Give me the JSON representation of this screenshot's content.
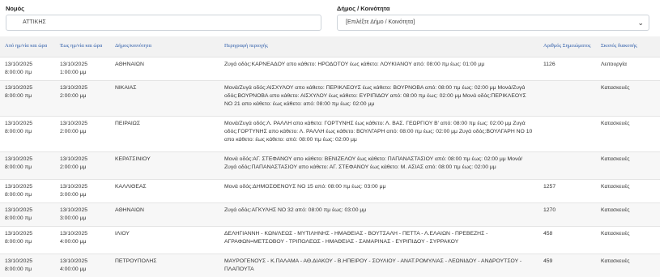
{
  "filters": {
    "prefecture": {
      "label": "Νομός",
      "value": "ΑΤΤΙΚΗΣ"
    },
    "municipality": {
      "label": "Δήμος / Κοινότητα",
      "value": "[Επιλέξτε Δήμο / Κοινότητα]"
    }
  },
  "table": {
    "headers": {
      "from": "Από ημ/νία και ώρα",
      "to": "Έως ημ/νία και ώρα",
      "municipality": "Δήμος/κοινότητα",
      "description": "Περιγραφή περιοχής",
      "count": "Αριθμός Σημειώματος",
      "purpose": "Σκοπός διακοπής"
    },
    "rows": [
      {
        "from_date": "13/10/2025",
        "from_time": "8:00:00 πμ",
        "to_date": "13/10/2025",
        "to_time": "1:00:00 μμ",
        "municipality": "ΑΘΗΝΑΙΩΝ",
        "description": "Ζυγά οδός:ΚΑΡΝΕΑΔΟΥ απο κάθετο: ΗΡΟΔΟΤΟΥ έως κάθετο: ΛΟΥΚΙΑΝΟΥ από: 08:00 πμ έως: 01:00 μμ",
        "count": "1126",
        "purpose": "Λειτουργία"
      },
      {
        "from_date": "13/10/2025",
        "from_time": "8:00:00 πμ",
        "to_date": "13/10/2025",
        "to_time": "2:00:00 μμ",
        "municipality": "ΝΙΚΑΙΑΣ",
        "description": "Μονά/Ζυγά οδός:ΑΙΣΧΥΛΟΥ απο κάθετο: ΠΕΡΙΚΛΕΟΥΣ έως κάθετο: ΒΟΥΡΝΟΒΑ από: 08:00 πμ έως: 02:00 μμ Μονά/Ζυγά οδός:ΒΟΥΡΝΟΒΑ απο κάθετο: ΑΙΣΧΥΛΟΥ έως κάθετο: ΕΥΡΙΠΙΔΟΥ από: 08:00 πμ έως: 02:00 μμ Μονά οδός:ΠΕΡΙΚΛΕΟΥΣ ΝΟ 21 απο κάθετο: έως κάθετο: από: 08:00 πμ έως: 02:00 μμ",
        "count": "",
        "purpose": "Κατασκευές"
      },
      {
        "from_date": "13/10/2025",
        "from_time": "8:00:00 πμ",
        "to_date": "13/10/2025",
        "to_time": "2:00:00 μμ",
        "municipality": "ΠΕΙΡΑΙΩΣ",
        "description": "Μονά/Ζυγά οδός:Λ. ΡΑΛΛΗ απο κάθετο: ΓΟΡΤΥΝΗΣ έως κάθετο: Λ. ΒΑΣ. ΓΕΩΡΓΙΟΥ Β' από: 08:00 πμ έως: 02:00 μμ Ζυγά οδός:ΓΟΡΤΥΝΗΣ απο κάθετο: Λ. ΡΑΛΛΗ έως κάθετο: ΒΟΥΛΓΑΡΗ από: 08:00 πμ έως: 02:00 μμ Ζυγά οδός:ΒΟΥΛΓΑΡΗ ΝΟ 10 απο κάθετο: έως κάθετο: από: 08:00 πμ έως: 02:00 μμ",
        "count": "",
        "purpose": "Κατασκευές"
      },
      {
        "from_date": "13/10/2025",
        "from_time": "8:00:00 πμ",
        "to_date": "13/10/2025",
        "to_time": "2:00:00 μμ",
        "municipality": "ΚΕΡΑΤΣΙΝΙΟΥ",
        "description": "Μονά οδός:ΑΓ. ΣΤΕΦΑΝΟΥ απο κάθετο: ΒΕΝΙΖΕΛΟΥ έως κάθετο: ΠΑΠΑΝΑΣΤΑΣΙΟΥ από: 08:00 πμ έως: 02:00 μμ Μονά/Ζυγά οδός:ΠΑΠΑΝΑΣΤΑΣΙΟΥ απο κάθετο: ΑΓ. ΣΤΕΦΑΝΟΥ έως κάθετο: Μ. ΑΣΙΑΣ από: 08:00 πμ έως: 02:00 μμ",
        "count": "",
        "purpose": "Κατασκευές"
      },
      {
        "from_date": "13/10/2025",
        "from_time": "8:00:00 πμ",
        "to_date": "13/10/2025",
        "to_time": "3:00:00 μμ",
        "municipality": "ΚΑΛΛΙΘΕΑΣ",
        "description": "Μονά οδός:ΔΗΜΟΣΘΕΝΟΥΣ ΝΟ 15 από: 08:00 πμ έως: 03:00 μμ",
        "count": "1257",
        "purpose": "Κατασκευές"
      },
      {
        "from_date": "13/10/2025",
        "from_time": "8:00:00 πμ",
        "to_date": "13/10/2025",
        "to_time": "3:00:00 μμ",
        "municipality": "ΑΘΗΝΑΙΩΝ",
        "description": "Ζυγά οδός:ΑΓΚΥΛΗΣ ΝΟ 32 από: 08:00 πμ έως: 03:00 μμ",
        "count": "1270",
        "purpose": "Κατασκευές"
      },
      {
        "from_date": "13/10/2025",
        "from_time": "8:00:00 πμ",
        "to_date": "13/10/2025",
        "to_time": "4:00:00 μμ",
        "municipality": "ΙΛΙΟΥ",
        "description": "ΔΕΛΗΓΙΑΝΝΗ - ΚΩΝ/ΛΕΩΣ - ΜΥΤΙΛΗΝΗΣ - ΗΜΑΘΕΙΑΣ - ΒΟΥΤΣΑΛΗ - ΠΕΤΤΑ - Λ.ΕΛΑΙΩΝ - ΠΡΕΒΕΖΗΣ - ΑΓΡΑΦΩΝ=ΜΕΤΣΟΒΟΥ - ΤΡΙΠΟΛΕΩΣ - ΗΜΑΘΕΙΑΣ - ΣΑΜΑΡΙΝΑΣ - ΕΥΡΙΠΙΔΟΥ - ΣΥΡΡΑΚΟΥ",
        "count": "458",
        "purpose": "Κατασκευές"
      },
      {
        "from_date": "13/10/2025",
        "from_time": "8:00:00 πμ",
        "to_date": "13/10/2025",
        "to_time": "4:00:00 μμ",
        "municipality": "ΠΕΤΡΟΥΠΟΛΗΣ",
        "description": "ΜΑΥΡΟΓΕΝΟΥΣ - Κ.ΠΑΛΑΜΑ - ΑΘ.ΔΙΑΚΟΥ - Β.ΗΠΕΙΡΟΥ - ΣΟΥΛΙΟΥ - ΑΝΑΤ.ΡΟΜΥΛΙΑΣ - ΛΕΩΝΙΔΟΥ - ΑΝΔΡΟΥΤΣΟΥ - ΠΛΑΠΟΥΤΑ",
        "count": "459",
        "purpose": "Κατασκευές"
      }
    ]
  }
}
